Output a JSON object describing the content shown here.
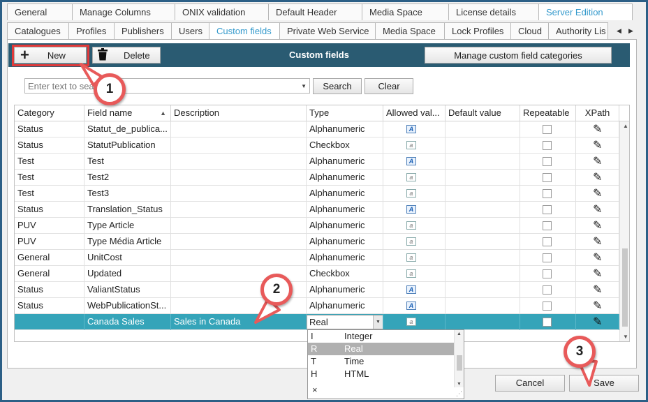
{
  "tabs_row1": [
    "General",
    "Manage Columns",
    "ONIX validation",
    "Default Header",
    "Media Space",
    "License details",
    "Server Edition"
  ],
  "tabs_row1_active": "Server Edition",
  "tabs_row2": [
    "Catalogues",
    "Profiles",
    "Publishers",
    "Users",
    "Custom fields",
    "Private Web Service",
    "Media Space",
    "Lock Profiles",
    "Cloud",
    "Authority Lis"
  ],
  "tabs_row2_active": "Custom fields",
  "toolbar": {
    "title": "Custom fields",
    "new_label": "New",
    "delete_label": "Delete",
    "manage_label": "Manage custom field categories"
  },
  "search": {
    "placeholder": "Enter text to search",
    "search_label": "Search",
    "clear_label": "Clear"
  },
  "grid": {
    "columns": [
      "Category",
      "Field name",
      "Description",
      "Type",
      "Allowed val...",
      "Default value",
      "Repeatable",
      "XPath"
    ],
    "rows": [
      {
        "category": "Status",
        "field": "Statut_de_publica...",
        "description": "",
        "type": "Alphanumeric",
        "allowed": true
      },
      {
        "category": "Status",
        "field": "StatutPublication",
        "description": "",
        "type": "Checkbox",
        "allowed": false
      },
      {
        "category": "Test",
        "field": "Test",
        "description": "",
        "type": "Alphanumeric",
        "allowed": true
      },
      {
        "category": "Test",
        "field": "Test2",
        "description": "",
        "type": "Alphanumeric",
        "allowed": false
      },
      {
        "category": "Test",
        "field": "Test3",
        "description": "",
        "type": "Alphanumeric",
        "allowed": false
      },
      {
        "category": "Status",
        "field": "Translation_Status",
        "description": "",
        "type": "Alphanumeric",
        "allowed": true
      },
      {
        "category": "PUV",
        "field": "Type Article",
        "description": "",
        "type": "Alphanumeric",
        "allowed": false
      },
      {
        "category": "PUV",
        "field": "Type Média Article",
        "description": "",
        "type": "Alphanumeric",
        "allowed": false
      },
      {
        "category": "General",
        "field": "UnitCost",
        "description": "",
        "type": "Alphanumeric",
        "allowed": false
      },
      {
        "category": "General",
        "field": "Updated",
        "description": "",
        "type": "Checkbox",
        "allowed": false
      },
      {
        "category": "Status",
        "field": "ValiantStatus",
        "description": "",
        "type": "Alphanumeric",
        "allowed": true
      },
      {
        "category": "Status",
        "field": "WebPublicationSt...",
        "description": "",
        "type": "Alphanumeric",
        "allowed": true
      }
    ],
    "selected_row": {
      "category": "",
      "field": "Canada Sales",
      "description": "Sales in Canada",
      "type": "Real"
    }
  },
  "type_dropdown": {
    "options": [
      {
        "code": "I",
        "name": "Integer"
      },
      {
        "code": "R",
        "name": "Real"
      },
      {
        "code": "T",
        "name": "Time"
      },
      {
        "code": "H",
        "name": "HTML"
      }
    ],
    "highlighted": "Real",
    "close_glyph": "×"
  },
  "footer": {
    "cancel_label": "Cancel",
    "save_label": "Save"
  },
  "markers": [
    "1",
    "2",
    "3"
  ],
  "colors": {
    "toolbar_bg": "#2a5b72",
    "selected_row": "#35a4b9",
    "active_tab": "#3399cc",
    "callout_red": "#e85a5a",
    "frame": "#2c5f86"
  }
}
